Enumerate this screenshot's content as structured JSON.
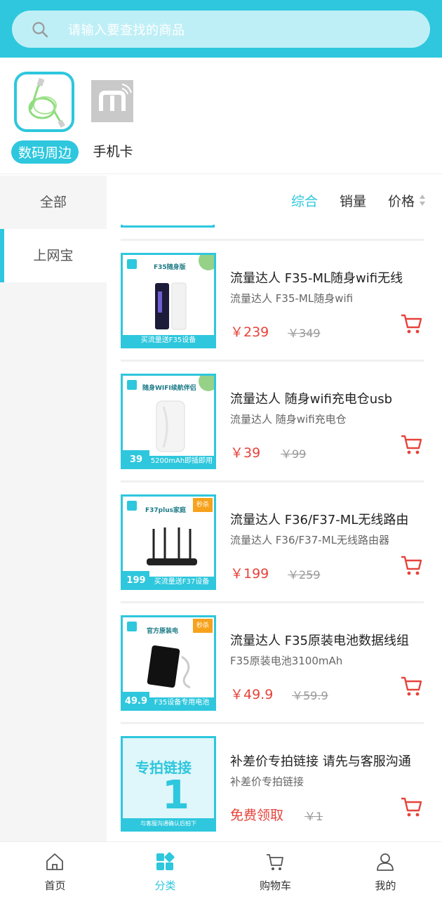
{
  "search": {
    "placeholder": "请输入要查找的商品"
  },
  "categories": [
    {
      "label": "数码周边",
      "icon": "cable-icon"
    },
    {
      "label": "手机卡",
      "icon": "sim-logo-icon"
    }
  ],
  "sidebar": {
    "items": [
      {
        "label": "全部"
      },
      {
        "label": "上网宝"
      }
    ]
  },
  "sort": {
    "items": [
      {
        "label": "综合"
      },
      {
        "label": "销量"
      },
      {
        "label": "价格"
      }
    ]
  },
  "products": [
    {
      "title": "流量达人 F35-ML随身wifi无线",
      "subtitle": "流量达人 F35-ML随身wifi",
      "price": "￥239",
      "orig": "￥349",
      "img_head": "F35随身版",
      "img_banner": "买流量送F35设备",
      "img_tag": ""
    },
    {
      "title": "流量达人 随身wifi充电仓usb",
      "subtitle": "流量达人 随身wifi充电仓",
      "price": "￥39",
      "orig": "￥99",
      "img_head": "随身WIFI续航伴侣",
      "img_banner": "5200mAh即插即用",
      "img_tag": "",
      "img_price": "39"
    },
    {
      "title": "流量达人 F36/F37-ML无线路由",
      "subtitle": "流量达人 F36/F37-ML无线路由器",
      "price": "￥199",
      "orig": "￥259",
      "img_head": "F37plus家庭",
      "img_banner": "买流量送F37设备",
      "img_tag": "秒杀",
      "img_price": "199"
    },
    {
      "title": "流量达人 F35原装电池数据线组",
      "subtitle": "F35原装电池3100mAh",
      "price": "￥49.9",
      "orig": "￥59.9",
      "img_head": "官方原装电",
      "img_banner": "F35设备专用电池",
      "img_tag": "秒杀",
      "img_price": "49.9"
    },
    {
      "title": "补差价专拍链接 请先与客服沟通",
      "subtitle": "补差价专拍链接",
      "price": "免费领取",
      "orig": "￥1",
      "img_head": "专拍链接",
      "img_banner": "与客服沟通确认后拍下",
      "img_tag": "",
      "img_big": "1"
    }
  ],
  "tabbar": {
    "items": [
      {
        "label": "首页"
      },
      {
        "label": "分类"
      },
      {
        "label": "购物车"
      },
      {
        "label": "我的"
      }
    ]
  },
  "colors": {
    "accent": "#2ec7dd",
    "price": "#e6433b"
  }
}
